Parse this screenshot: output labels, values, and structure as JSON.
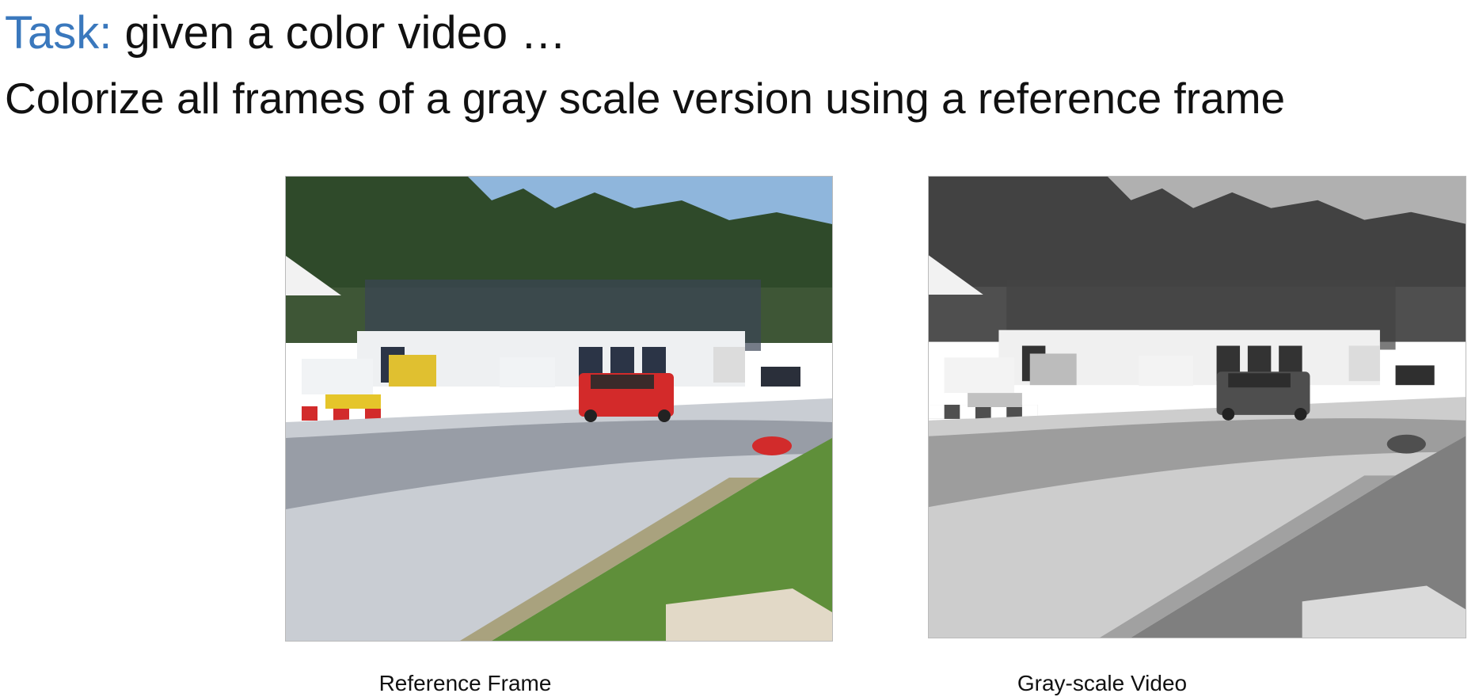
{
  "heading": {
    "task_label": "Task:",
    "task_text": " given a color video …",
    "subtitle": "Colorize all frames of a gray scale version using a reference frame"
  },
  "panels": [
    {
      "caption": "Reference Frame",
      "mode": "color"
    },
    {
      "caption": "Gray-scale Video",
      "mode": "grayscale"
    }
  ],
  "colors": {
    "task_label": "#3a78bd",
    "sky": "#8fb6dc",
    "trees": "#2f4a2a",
    "grass": "#5f8f3a",
    "asphalt": "#c9cdd3",
    "car": "#d32a2a"
  }
}
